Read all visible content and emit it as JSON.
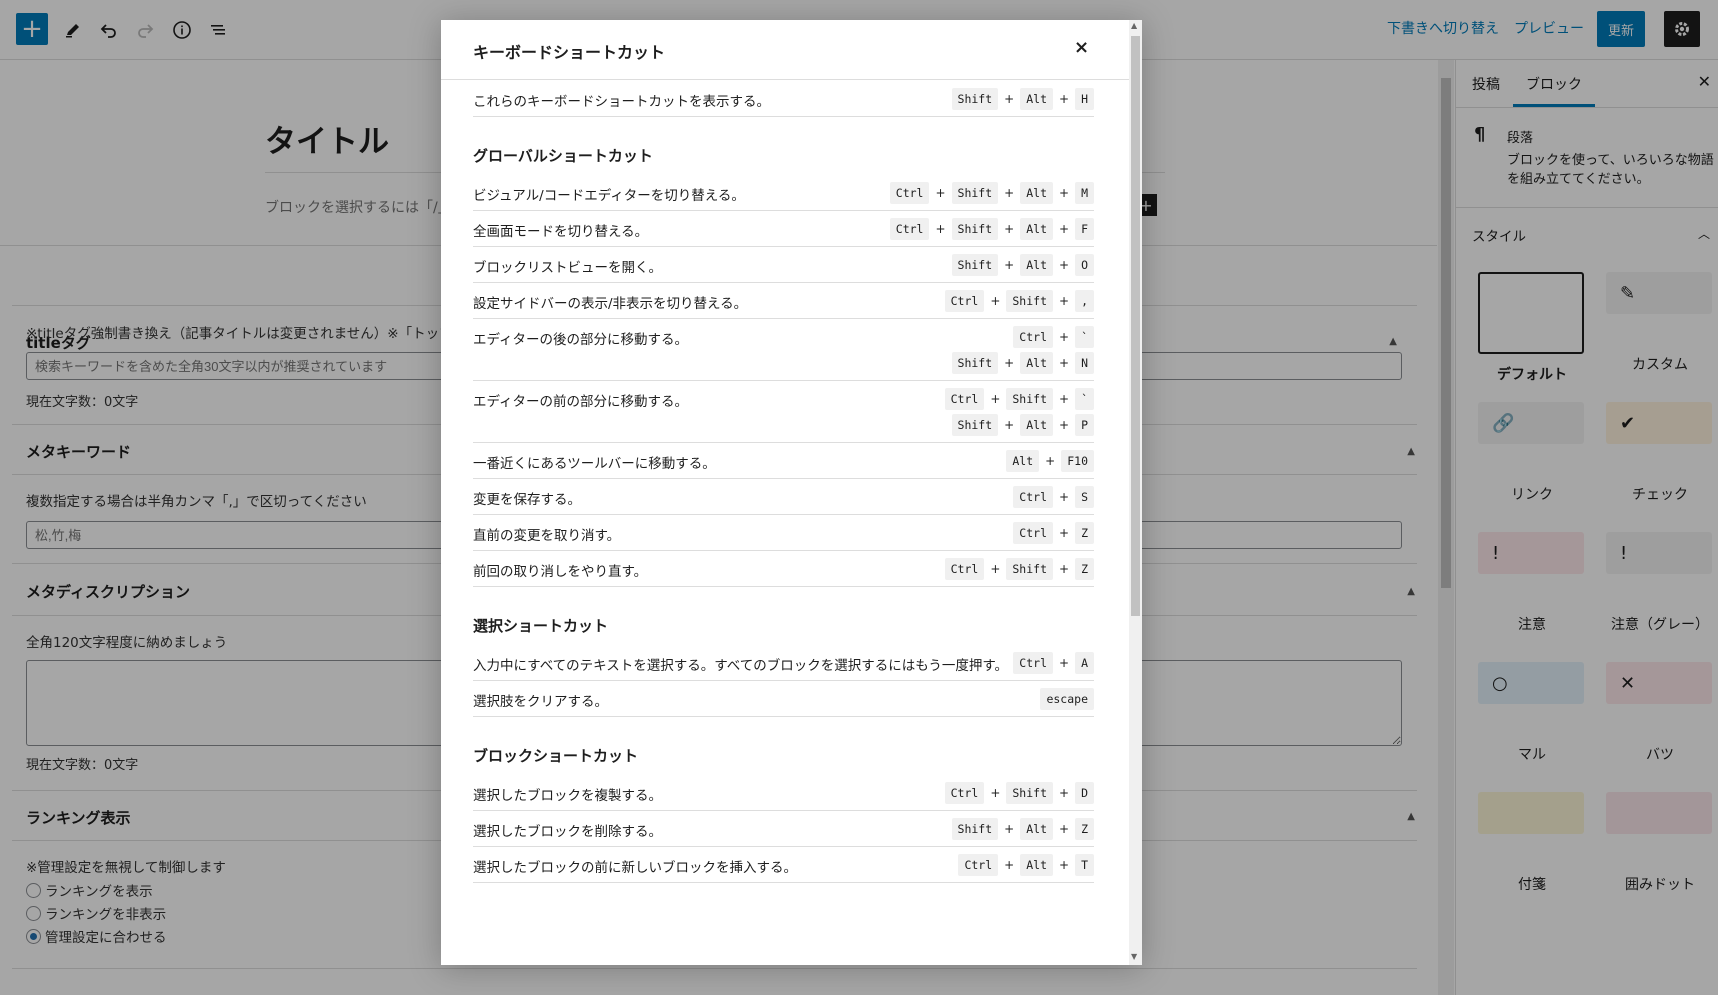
{
  "toolbar": {
    "switch_draft": "下書きへ切り替え",
    "preview": "プレビュー",
    "update": "更新"
  },
  "editor": {
    "post_title": "タイトル",
    "placeholder": "ブロックを選択するには「/」を入力",
    "meta": {
      "title_tag": {
        "heading": "titleタグ",
        "desc": "※titleタグ強制書き換え（記事タイトルは変更されません）※「トップ",
        "placeholder": "検索キーワードを含めた全角30文字以内が推奨されています",
        "count": "現在文字数：0文字"
      },
      "keywords": {
        "heading": "メタキーワード",
        "desc": "複数指定する場合は半角カンマ「,」で区切ってください",
        "placeholder": "松,竹,梅"
      },
      "description": {
        "heading": "メタディスクリプション",
        "desc": "全角120文字程度に納めましょう",
        "count": "現在文字数：0文字"
      },
      "ranking": {
        "heading": "ランキング表示",
        "desc": "※管理設定を無視して制御します",
        "options": [
          "ランキングを表示",
          "ランキングを非表示",
          "管理設定に合わせる"
        ],
        "selected_index": 2
      }
    }
  },
  "sidebar": {
    "tabs": [
      "投稿",
      "ブロック"
    ],
    "active_tab": "ブロック",
    "block_name": "段落",
    "block_desc": "ブロックを使って、いろいろな物語を組み立ててください。",
    "styles_heading": "スタイル",
    "styles": [
      {
        "label": "デフォルト",
        "icon": "",
        "color": "#ffffff"
      },
      {
        "label": "カスタム",
        "icon": "✎",
        "color": "#f3f3f3"
      },
      {
        "label": "リンク",
        "icon": "🔗",
        "color": "#f3f3f3"
      },
      {
        "label": "チェック",
        "icon": "✔",
        "color": "#fff3df"
      },
      {
        "label": "注意",
        "icon": "!",
        "color": "#fde8ec"
      },
      {
        "label": "注意（グレー）",
        "icon": "!",
        "color": "#f3f3f3"
      },
      {
        "label": "マル",
        "icon": "○",
        "color": "#e4f2fb"
      },
      {
        "label": "バツ",
        "icon": "✕",
        "color": "#fde8ec"
      },
      {
        "label": "付箋",
        "icon": "",
        "color": "#fcf6d8"
      },
      {
        "label": "囲みドット",
        "icon": "",
        "color": "#fbe6ec"
      }
    ]
  },
  "modal": {
    "title": "キーボードショートカット",
    "close": "×",
    "intro": {
      "desc": "これらのキーボードショートカットを表示する。",
      "keys": [
        [
          "Shift",
          "Alt",
          "H"
        ]
      ]
    },
    "sections": [
      {
        "heading": "グローバルショートカット",
        "rows": [
          {
            "desc": "ビジュアル/コードエディターを切り替える。",
            "keys": [
              [
                "Ctrl",
                "Shift",
                "Alt",
                "M"
              ]
            ]
          },
          {
            "desc": "全画面モードを切り替える。",
            "keys": [
              [
                "Ctrl",
                "Shift",
                "Alt",
                "F"
              ]
            ]
          },
          {
            "desc": "ブロックリストビューを開く。",
            "keys": [
              [
                "Shift",
                "Alt",
                "O"
              ]
            ]
          },
          {
            "desc": "設定サイドバーの表示/非表示を切り替える。",
            "keys": [
              [
                "Ctrl",
                "Shift",
                ","
              ]
            ]
          },
          {
            "desc": "エディターの後の部分に移動する。",
            "keys": [
              [
                "Ctrl",
                "`"
              ],
              [
                "Shift",
                "Alt",
                "N"
              ]
            ]
          },
          {
            "desc": "エディターの前の部分に移動する。",
            "keys": [
              [
                "Ctrl",
                "Shift",
                "`"
              ],
              [
                "Shift",
                "Alt",
                "P"
              ]
            ]
          },
          {
            "desc": "一番近くにあるツールバーに移動する。",
            "keys": [
              [
                "Alt",
                "F10"
              ]
            ]
          },
          {
            "desc": "変更を保存する。",
            "keys": [
              [
                "Ctrl",
                "S"
              ]
            ]
          },
          {
            "desc": "直前の変更を取り消す。",
            "keys": [
              [
                "Ctrl",
                "Z"
              ]
            ]
          },
          {
            "desc": "前回の取り消しをやり直す。",
            "keys": [
              [
                "Ctrl",
                "Shift",
                "Z"
              ]
            ]
          }
        ]
      },
      {
        "heading": "選択ショートカット",
        "rows": [
          {
            "desc": "入力中にすべてのテキストを選択する。すべてのブロックを選択するにはもう一度押す。",
            "keys": [
              [
                "Ctrl",
                "A"
              ]
            ]
          },
          {
            "desc": "選択肢をクリアする。",
            "keys": [
              [
                "escape"
              ]
            ]
          }
        ]
      },
      {
        "heading": "ブロックショートカット",
        "rows": [
          {
            "desc": "選択したブロックを複製する。",
            "keys": [
              [
                "Ctrl",
                "Shift",
                "D"
              ]
            ]
          },
          {
            "desc": "選択したブロックを削除する。",
            "keys": [
              [
                "Shift",
                "Alt",
                "Z"
              ]
            ]
          },
          {
            "desc": "選択したブロックの前に新しいブロックを挿入する。",
            "keys": [
              [
                "Ctrl",
                "Alt",
                "T"
              ]
            ]
          }
        ]
      }
    ]
  }
}
